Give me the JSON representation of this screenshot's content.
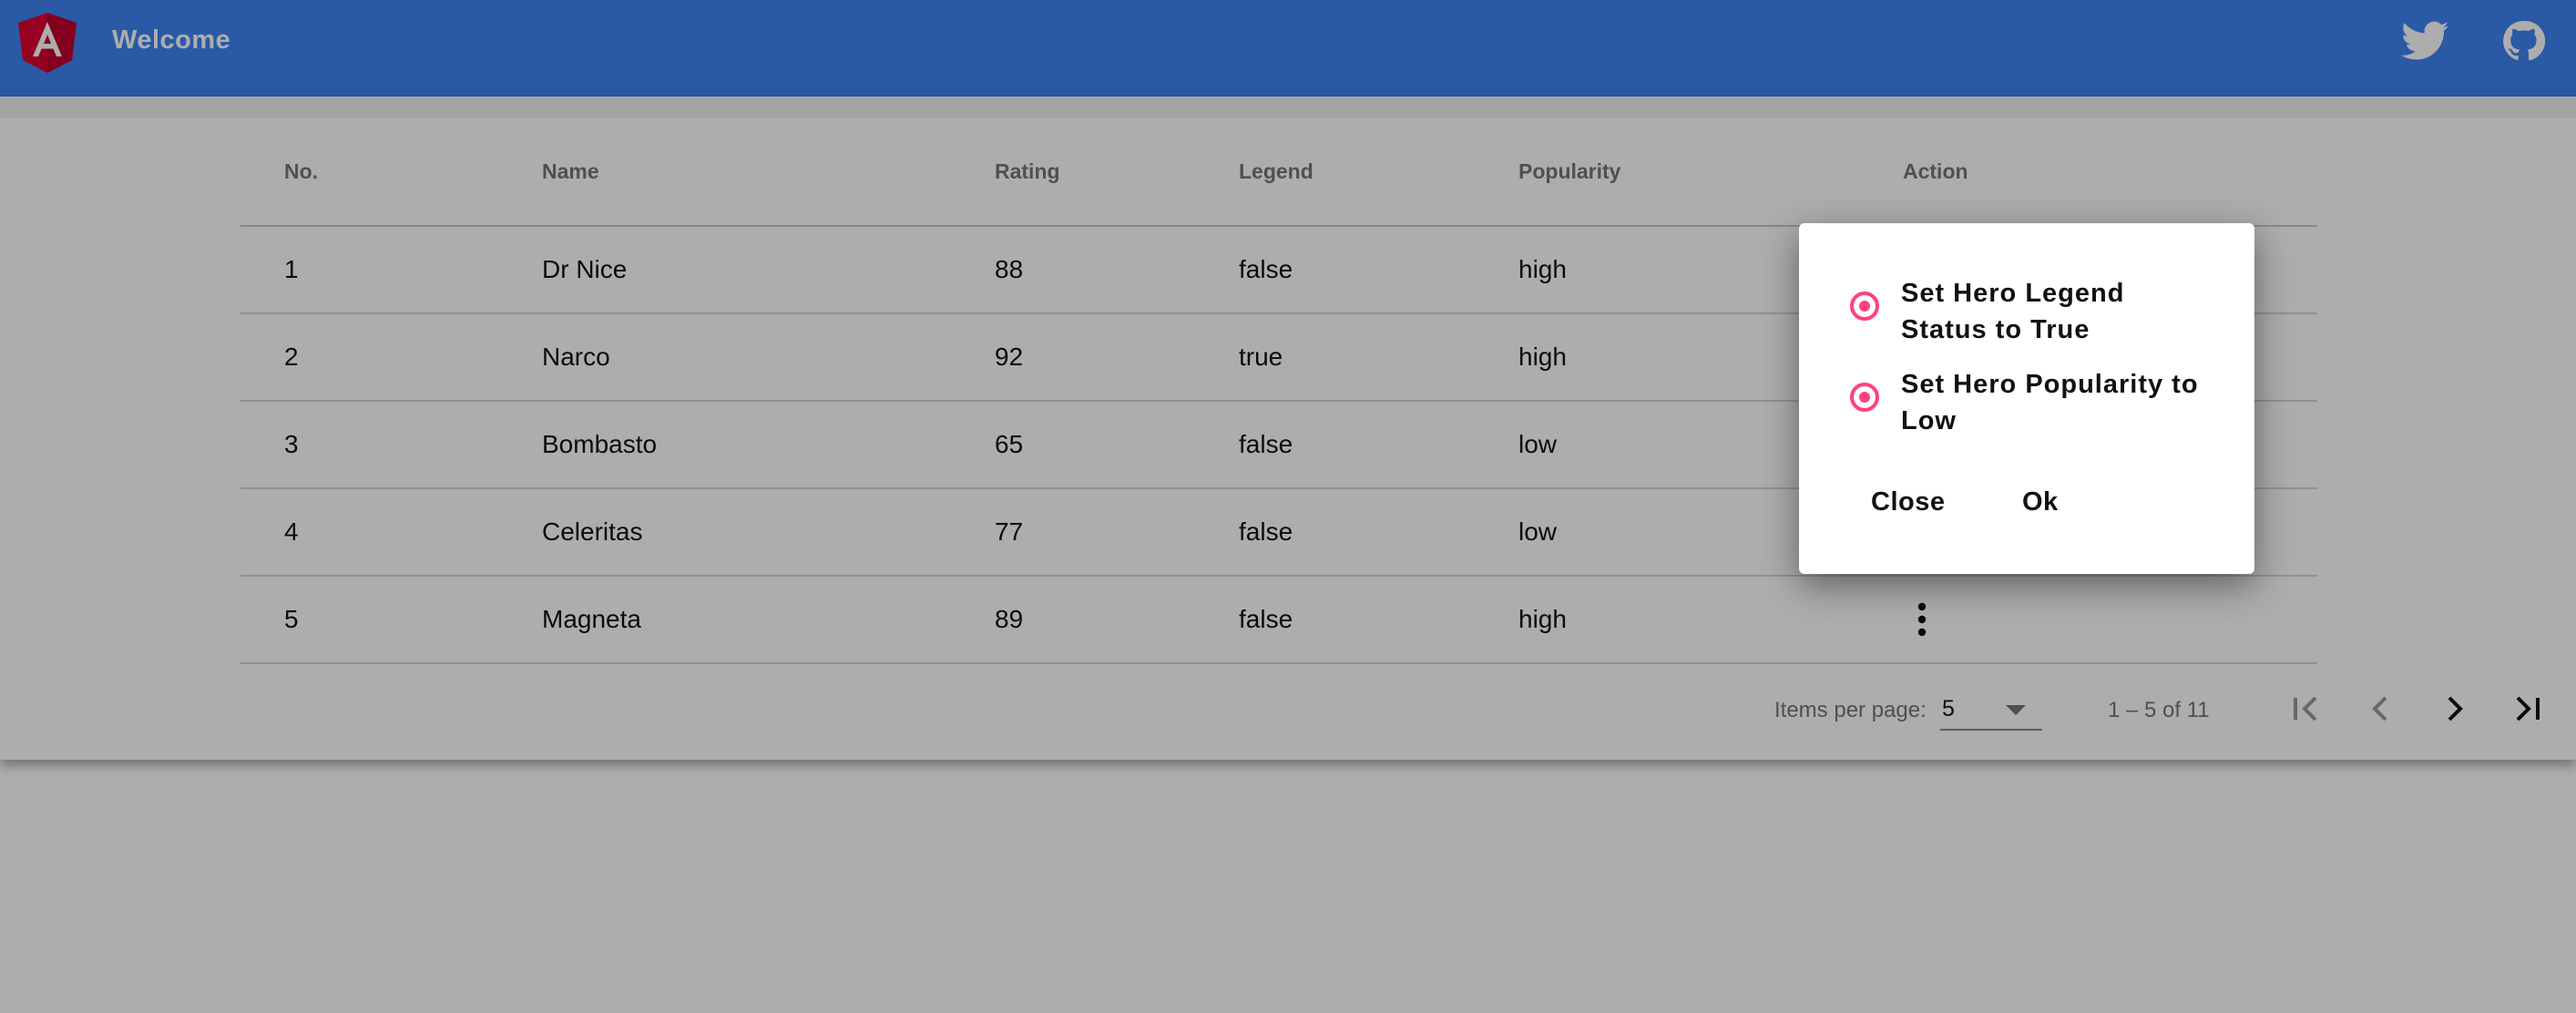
{
  "toolbar": {
    "title": "Welcome",
    "background": "#3f83f4",
    "icons": [
      "angular-logo",
      "twitter-icon",
      "github-icon"
    ]
  },
  "table": {
    "headers": [
      "No.",
      "Name",
      "Rating",
      "Legend",
      "Popularity",
      "Action"
    ],
    "rows": [
      {
        "no": "1",
        "name": "Dr Nice",
        "rating": "88",
        "legend": "false",
        "popularity": "high"
      },
      {
        "no": "2",
        "name": "Narco",
        "rating": "92",
        "legend": "true",
        "popularity": "high"
      },
      {
        "no": "3",
        "name": "Bombasto",
        "rating": "65",
        "legend": "false",
        "popularity": "low"
      },
      {
        "no": "4",
        "name": "Celeritas",
        "rating": "77",
        "legend": "false",
        "popularity": "low"
      },
      {
        "no": "5",
        "name": "Magneta",
        "rating": "89",
        "legend": "false",
        "popularity": "high"
      }
    ]
  },
  "paginator": {
    "items_per_page_label": "Items per page:",
    "page_size": "5",
    "range_label": "1 – 5 of 11"
  },
  "dialog": {
    "option_1": "Set Hero Legend Status to True",
    "option_2": "Set Hero Popularity to Low",
    "close_label": "Close",
    "ok_label": "Ok",
    "accent": "#ff4081"
  }
}
